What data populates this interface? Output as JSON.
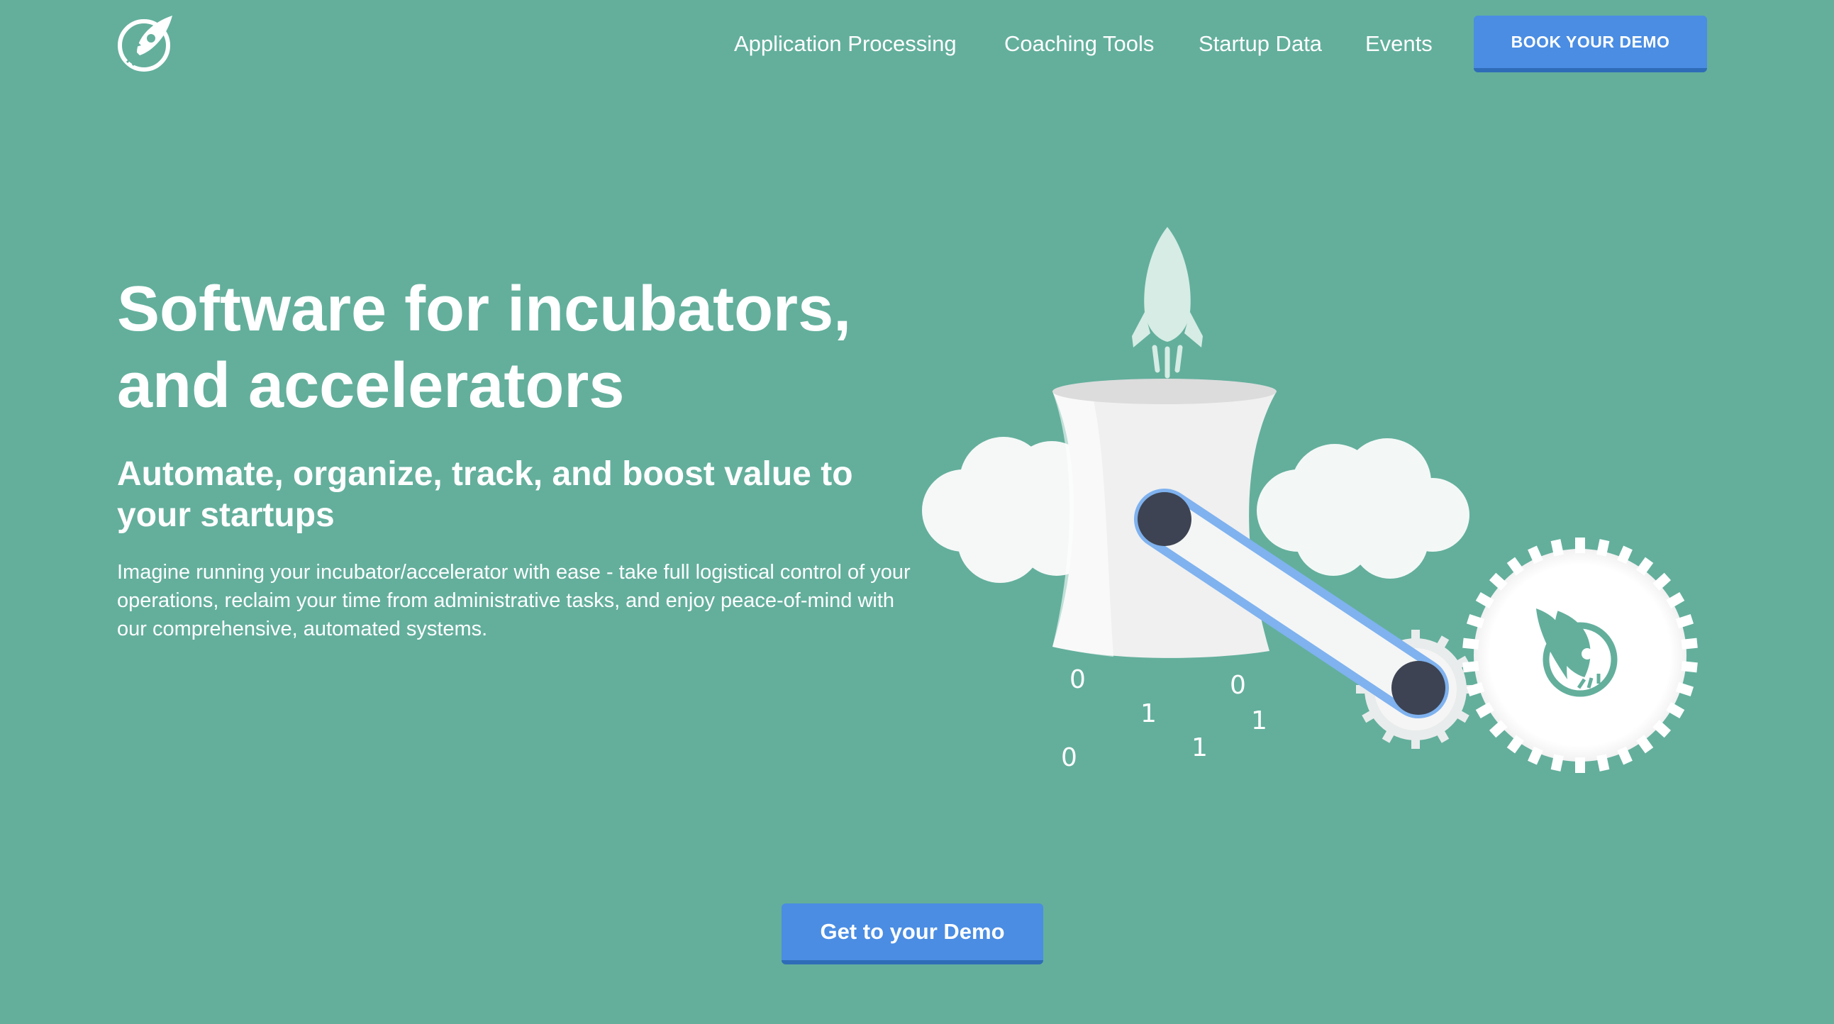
{
  "nav": {
    "items": [
      {
        "label": "Application Processing"
      },
      {
        "label": "Coaching Tools"
      },
      {
        "label": "Startup Data"
      },
      {
        "label": "Events"
      }
    ],
    "demo_button": "BOOK YOUR DEMO"
  },
  "hero": {
    "title_line1": "Software for incubators,",
    "title_line2": "and accelerators",
    "subtitle": "Automate, organize, track, and boost value to your startups",
    "body": "Imagine running your incubator/accelerator with ease - take full logistical control of your operations, reclaim your time from administrative tasks, and enjoy peace-of-mind with our comprehensive, automated systems."
  },
  "illustration": {
    "binary_digits": [
      "0",
      "1",
      "0",
      "1",
      "0",
      "1"
    ]
  },
  "cta": {
    "label": "Get to your Demo"
  },
  "colors": {
    "background": "#63af9c",
    "button": "#4a8de3",
    "button_shadow": "#2f6cb8",
    "link_bar": "#7fb2ef",
    "gear": "#ffffff",
    "knob": "#3d4352"
  }
}
